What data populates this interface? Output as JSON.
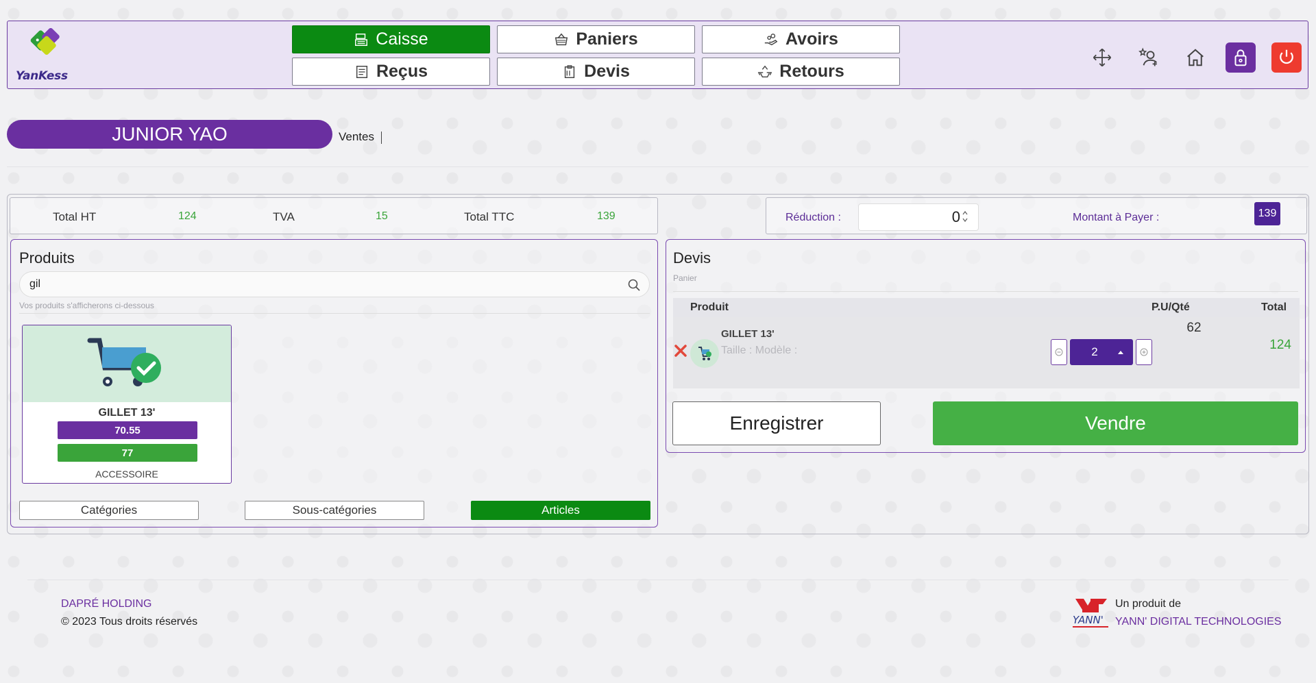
{
  "brand": {
    "logo_text": "YanKess"
  },
  "nav": {
    "caisse": "Caisse",
    "paniers": "Paniers",
    "avoirs": "Avoirs",
    "recus": "Reçus",
    "devis": "Devis",
    "retours": "Retours"
  },
  "header_icons": [
    "move-icon",
    "user-star-icon",
    "home-icon",
    "lock-icon",
    "power-icon"
  ],
  "user": {
    "name": "JUNIOR YAO",
    "section": "Ventes"
  },
  "totals": {
    "ht_label": "Total HT",
    "ht_value": "124",
    "tva_label": "TVA",
    "tva_value": "15",
    "ttc_label": "Total TTC",
    "ttc_value": "139"
  },
  "payment": {
    "reduction_label": "Réduction :",
    "reduction_value": "0",
    "amount_label": "Montant à Payer :",
    "amount_value": "139"
  },
  "products": {
    "title": "Produits",
    "search_value": "gil",
    "hint": "Vos produits s'afficherons ci-dessous",
    "items": [
      {
        "name": "GILLET 13'",
        "price_a": "70.55",
        "price_b": "77",
        "category": "ACCESSOIRE"
      }
    ],
    "tabs": {
      "categories": "Catégories",
      "sous_categories": "Sous-catégories",
      "articles": "Articles"
    }
  },
  "devis": {
    "title": "Devis",
    "subtitle": "Panier",
    "columns": {
      "produit": "Produit",
      "pu_qte": "P.U/Qté",
      "total": "Total"
    },
    "rows": [
      {
        "name": "GILLET 13'",
        "attrs": "Taille : Modèle :",
        "unit_price": "62",
        "qty": "2",
        "total": "124"
      }
    ],
    "save_label": "Enregistrer",
    "sell_label": "Vendre"
  },
  "footer": {
    "company": "DAPRÉ HOLDING",
    "copyright": "© 2023 Tous droits réservés",
    "product_by": "Un produit de",
    "vendor": "YANN' DIGITAL TECHNOLOGIES"
  },
  "colors": {
    "purple": "#6a2fa0",
    "green_active": "#0b8a12",
    "green_sell": "#45b045",
    "value_green": "#3aa43a",
    "power_red": "#ee3b2f"
  }
}
